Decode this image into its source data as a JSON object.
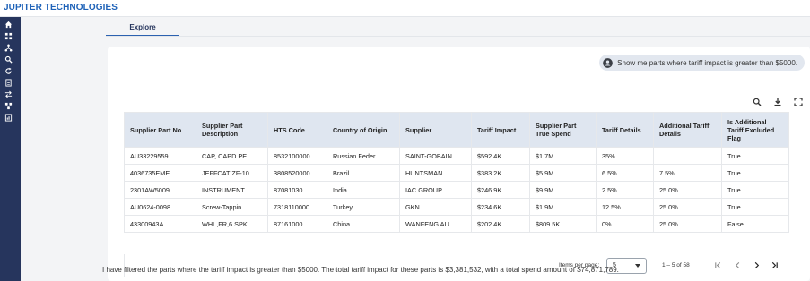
{
  "app": {
    "title": "JUPITER TECHNOLOGIES"
  },
  "sidebar": {
    "icons": [
      "home-icon",
      "grid-icon",
      "network-icon",
      "search-icon",
      "refresh-icon",
      "building-icon",
      "transfer-icon",
      "hierarchy-icon",
      "report-icon"
    ]
  },
  "tabs": [
    {
      "label": "Explore"
    }
  ],
  "query": {
    "text": "Show me parts where tariff impact is greater than $5000."
  },
  "toolbar": {
    "icons": [
      "search-icon",
      "download-icon",
      "fullscreen-icon"
    ]
  },
  "table": {
    "columns": [
      "Supplier Part No",
      "Supplier Part Description",
      "HTS Code",
      "Country of Origin",
      "Supplier",
      "Tariff Impact",
      "Supplier Part True Spend",
      "Tariff Details",
      "Additional Tariff Details",
      "Is Additional Tariff Excluded Flag"
    ],
    "rows": [
      [
        "AU33229559",
        "CAP, CAPD PE...",
        "8532100000",
        "Russian Feder...",
        "SAINT-GOBAIN.",
        "$592.4K",
        "$1.7M",
        "35%",
        "",
        "True"
      ],
      [
        "4036735EME...",
        "JEFFCAT ZF-10",
        "3808520000",
        "Brazil",
        "HUNTSMAN.",
        "$383.2K",
        "$5.9M",
        "6.5%",
        "7.5%",
        "True"
      ],
      [
        "2301AW5009...",
        "INSTRUMENT ...",
        "87081030",
        "India",
        "IAC GROUP.",
        "$246.9K",
        "$9.9M",
        "2.5%",
        "25.0%",
        "True"
      ],
      [
        "AU0624-0098",
        "Screw-Tappin...",
        "7318110000",
        "Turkey",
        "GKN.",
        "$234.6K",
        "$1.9M",
        "12.5%",
        "25.0%",
        "True"
      ],
      [
        "43300943A",
        "WHL,FR,6 SPK...",
        "87161000",
        "China",
        "WANFENG AU...",
        "$202.4K",
        "$809.5K",
        "0%",
        "25.0%",
        "False"
      ]
    ]
  },
  "pagination": {
    "items_per_page_label": "Items per page:",
    "items_per_page_value": "5",
    "range_text": "1 – 5 of 58"
  },
  "summary": "I have filtered the parts where the tariff impact is greater than $5000. The total tariff impact for these parts is $3,381,532, with a total spend amount of $74,871,789.",
  "colors": {
    "brand": "#1e62b8",
    "sidebar": "#26355d",
    "header_bg": "#dfe6f0",
    "tab_accent": "#2b61b0"
  }
}
